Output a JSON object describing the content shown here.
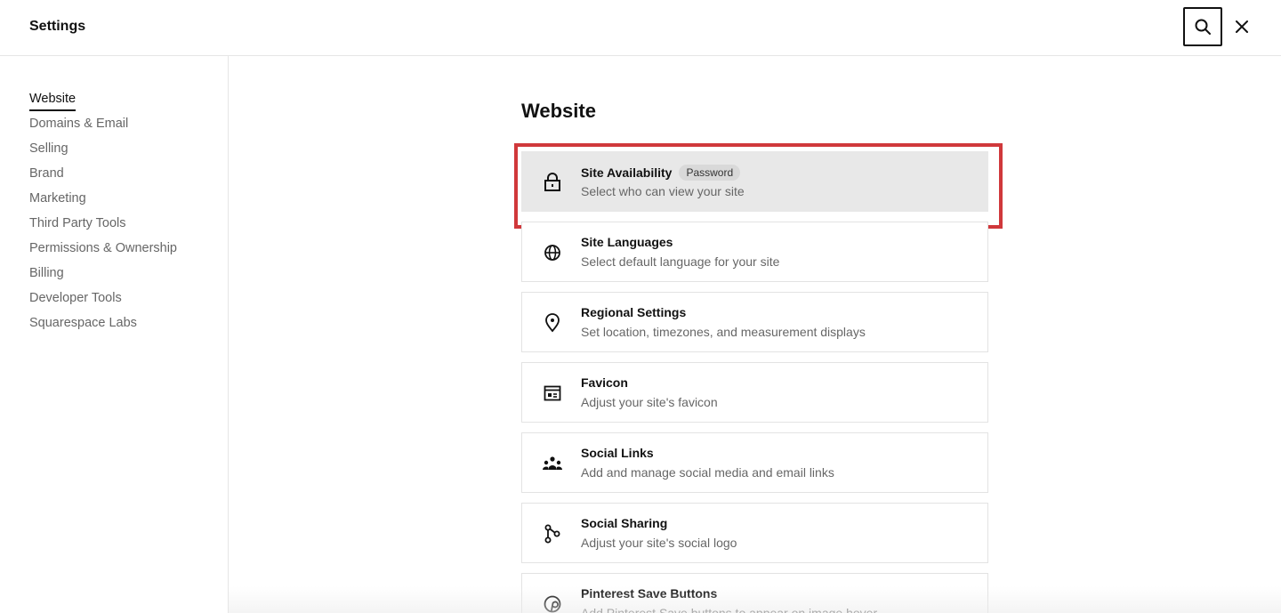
{
  "header": {
    "title": "Settings"
  },
  "sidebar": {
    "items": [
      {
        "label": "Website",
        "active": true
      },
      {
        "label": "Domains & Email"
      },
      {
        "label": "Selling"
      },
      {
        "label": "Brand"
      },
      {
        "label": "Marketing"
      },
      {
        "label": "Third Party Tools"
      },
      {
        "label": "Permissions & Ownership"
      },
      {
        "label": "Billing"
      },
      {
        "label": "Developer Tools"
      },
      {
        "label": "Squarespace Labs"
      }
    ]
  },
  "main": {
    "heading": "Website",
    "cards": [
      {
        "icon": "lock-icon",
        "label": "Site Availability",
        "badge": "Password",
        "desc": "Select who can view your site"
      },
      {
        "icon": "globe-icon",
        "label": "Site Languages",
        "desc": "Select default language for your site"
      },
      {
        "icon": "location-pin-icon",
        "label": "Regional Settings",
        "desc": "Set location, timezones, and measurement displays"
      },
      {
        "icon": "favicon-icon",
        "label": "Favicon",
        "desc": "Adjust your site's favicon"
      },
      {
        "icon": "people-icon",
        "label": "Social Links",
        "desc": "Add and manage social media and email links"
      },
      {
        "icon": "share-icon",
        "label": "Social Sharing",
        "desc": "Adjust your site's social logo"
      },
      {
        "icon": "pinterest-icon",
        "label": "Pinterest Save Buttons",
        "desc": "Add Pinterest Save buttons to appear on image hover"
      }
    ]
  },
  "colors": {
    "highlight_border": "#d0383b",
    "selected_card_bg": "#e8e8e8"
  }
}
